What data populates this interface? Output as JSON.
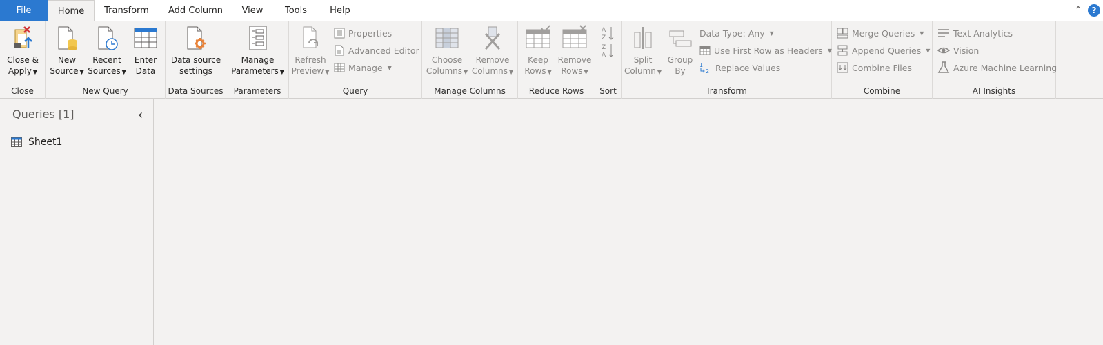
{
  "tabs": [
    "File",
    "Home",
    "Transform",
    "Add Column",
    "View",
    "Tools",
    "Help"
  ],
  "ribbon": {
    "close": {
      "btn1": "Close &",
      "btn2": "Apply",
      "label": "Close"
    },
    "new_query": {
      "new1": "New",
      "new2": "Source",
      "recent1": "Recent",
      "recent2": "Sources",
      "enter1": "Enter",
      "enter2": "Data",
      "label": "New Query"
    },
    "data_sources": {
      "btn1": "Data source",
      "btn2": "settings",
      "label": "Data Sources"
    },
    "parameters": {
      "btn1": "Manage",
      "btn2": "Parameters",
      "label": "Parameters"
    },
    "query": {
      "refresh1": "Refresh",
      "refresh2": "Preview",
      "properties": "Properties",
      "advanced": "Advanced Editor",
      "manage": "Manage",
      "label": "Query"
    },
    "manage_columns": {
      "choose1": "Choose",
      "choose2": "Columns",
      "remove1": "Remove",
      "remove2": "Columns",
      "label": "Manage Columns"
    },
    "reduce_rows": {
      "keep1": "Keep",
      "keep2": "Rows",
      "remove1": "Remove",
      "remove2": "Rows",
      "label": "Reduce Rows"
    },
    "sort": {
      "label": "Sort"
    },
    "transform": {
      "split1": "Split",
      "split2": "Column",
      "group1": "Group",
      "group2": "By",
      "datatype": "Data Type: Any",
      "firstrow": "Use First Row as Headers",
      "replace": "Replace Values",
      "label": "Transform"
    },
    "combine": {
      "merge": "Merge Queries",
      "append": "Append Queries",
      "files": "Combine Files",
      "label": "Combine"
    },
    "ai": {
      "text": "Text Analytics",
      "vision": "Vision",
      "azure": "Azure Machine Learning",
      "label": "AI Insights"
    }
  },
  "queries": {
    "title": "Queries [1]",
    "items": [
      "Sheet1"
    ]
  }
}
